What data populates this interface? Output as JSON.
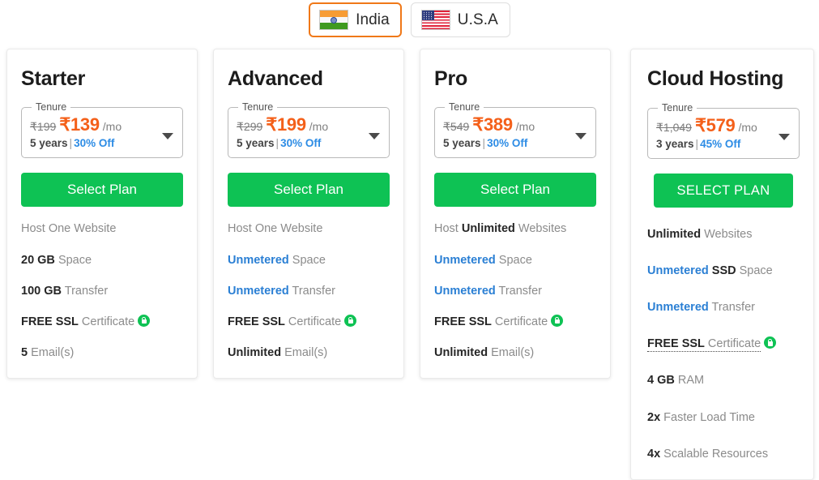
{
  "country_switch": {
    "options": [
      {
        "label": "India",
        "flag": "india-flag-icon",
        "active": true
      },
      {
        "label": "U.S.A",
        "flag": "usa-flag-icon",
        "active": false
      }
    ]
  },
  "colors": {
    "accent_green": "#0ec254",
    "price_orange": "#f4601a",
    "link_blue": "#2a7fd4",
    "discount_blue": "#2d8ce5",
    "active_border_orange": "#f07818",
    "muted_text": "#8b8b8b",
    "dark_text": "#262626"
  },
  "tenure_legend": "Tenure",
  "plans": [
    {
      "title": "Starter",
      "old_price": "₹199",
      "new_price": "₹139",
      "per": "/mo",
      "term": "5 years",
      "separator": "|",
      "discount": "30% Off",
      "cta": "Select Plan",
      "features": [
        {
          "parts": [
            {
              "text": "Host One Website",
              "style": "plain"
            }
          ]
        },
        {
          "parts": [
            {
              "text": "20 GB",
              "style": "bold-dark"
            },
            {
              "text": " Space",
              "style": "plain"
            }
          ]
        },
        {
          "parts": [
            {
              "text": "100 GB",
              "style": "bold-dark"
            },
            {
              "text": " Transfer",
              "style": "plain"
            }
          ]
        },
        {
          "parts": [
            {
              "text": "FREE SSL",
              "style": "bold-dark"
            },
            {
              "text": " Certificate",
              "style": "plain"
            }
          ],
          "lock": true
        },
        {
          "parts": [
            {
              "text": "5",
              "style": "bold-dark"
            },
            {
              "text": " Email(s)",
              "style": "plain"
            }
          ]
        }
      ]
    },
    {
      "title": "Advanced",
      "old_price": "₹299",
      "new_price": "₹199",
      "per": "/mo",
      "term": "5 years",
      "separator": "|",
      "discount": "30% Off",
      "cta": "Select Plan",
      "features": [
        {
          "parts": [
            {
              "text": "Host One Website",
              "style": "plain"
            }
          ]
        },
        {
          "parts": [
            {
              "text": "Unmetered",
              "style": "bold-blue"
            },
            {
              "text": " Space",
              "style": "plain"
            }
          ]
        },
        {
          "parts": [
            {
              "text": "Unmetered",
              "style": "bold-blue"
            },
            {
              "text": " Transfer",
              "style": "plain"
            }
          ]
        },
        {
          "parts": [
            {
              "text": "FREE SSL",
              "style": "bold-dark"
            },
            {
              "text": " Certificate",
              "style": "plain"
            }
          ],
          "lock": true
        },
        {
          "parts": [
            {
              "text": "Unlimited",
              "style": "bold-dark"
            },
            {
              "text": " Email(s)",
              "style": "plain"
            }
          ]
        }
      ]
    },
    {
      "title": "Pro",
      "old_price": "₹549",
      "new_price": "₹389",
      "per": "/mo",
      "term": "5 years",
      "separator": "|",
      "discount": "30% Off",
      "cta": "Select Plan",
      "features": [
        {
          "parts": [
            {
              "text": "Host ",
              "style": "plain"
            },
            {
              "text": "Unlimited",
              "style": "bold-dark"
            },
            {
              "text": " Websites",
              "style": "plain"
            }
          ]
        },
        {
          "parts": [
            {
              "text": "Unmetered",
              "style": "bold-blue"
            },
            {
              "text": " Space",
              "style": "plain"
            }
          ]
        },
        {
          "parts": [
            {
              "text": "Unmetered",
              "style": "bold-blue"
            },
            {
              "text": " Transfer",
              "style": "plain"
            }
          ]
        },
        {
          "parts": [
            {
              "text": "FREE SSL",
              "style": "bold-dark"
            },
            {
              "text": " Certificate",
              "style": "plain"
            }
          ],
          "lock": true
        },
        {
          "parts": [
            {
              "text": "Unlimited",
              "style": "bold-dark"
            },
            {
              "text": " Email(s)",
              "style": "plain"
            }
          ]
        }
      ]
    },
    {
      "title": "Cloud Hosting",
      "featured": true,
      "old_price": "₹1,049",
      "new_price": "₹579",
      "per": "/mo",
      "term": "3 years",
      "separator": "|",
      "discount": "45% Off",
      "cta": "SELECT PLAN",
      "features": [
        {
          "parts": [
            {
              "text": "Unlimited",
              "style": "bold-dark"
            },
            {
              "text": " Websites",
              "style": "plain"
            }
          ]
        },
        {
          "parts": [
            {
              "text": "Unmetered",
              "style": "bold-blue"
            },
            {
              "text": " SSD",
              "style": "bold-dark"
            },
            {
              "text": " Space",
              "style": "plain"
            }
          ]
        },
        {
          "parts": [
            {
              "text": "Unmetered",
              "style": "bold-blue"
            },
            {
              "text": " Transfer",
              "style": "plain"
            }
          ]
        },
        {
          "parts": [
            {
              "text": "FREE SSL",
              "style": "bold-dark"
            },
            {
              "text": " Certificate",
              "style": "plain"
            }
          ],
          "lock": true,
          "dotted": true
        },
        {
          "parts": [
            {
              "text": "4 GB",
              "style": "bold-dark"
            },
            {
              "text": " RAM",
              "style": "plain"
            }
          ]
        },
        {
          "parts": [
            {
              "text": "2x",
              "style": "bold-dark"
            },
            {
              "text": " Faster Load Time",
              "style": "plain"
            }
          ]
        },
        {
          "parts": [
            {
              "text": "4x",
              "style": "bold-dark"
            },
            {
              "text": " Scalable Resources",
              "style": "plain"
            }
          ]
        }
      ]
    }
  ]
}
